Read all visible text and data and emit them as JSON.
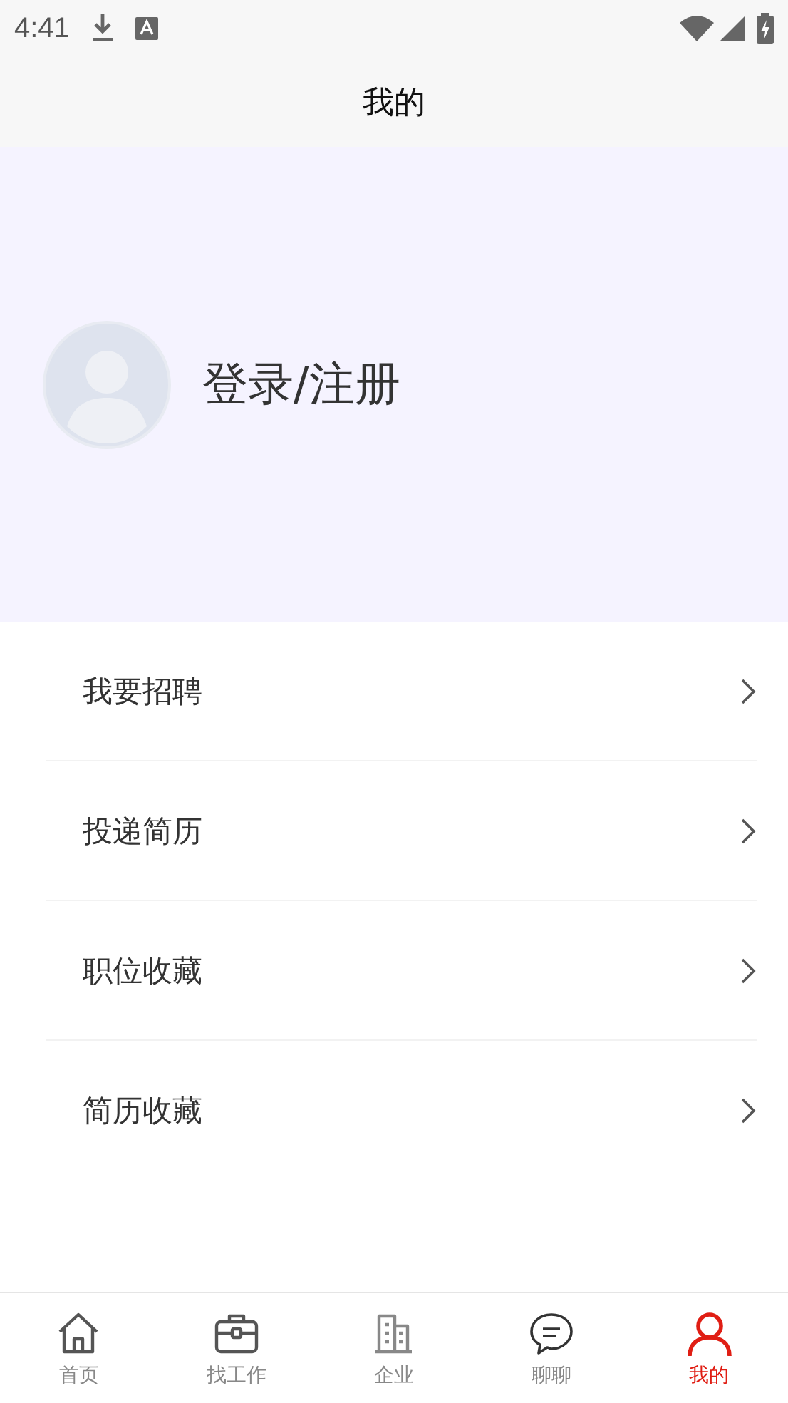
{
  "status_bar": {
    "time": "4:41"
  },
  "header": {
    "title": "我的"
  },
  "profile": {
    "login_text": "登录/注册"
  },
  "menu": [
    {
      "label": "我要招聘"
    },
    {
      "label": "投递简历"
    },
    {
      "label": "职位收藏"
    },
    {
      "label": "简历收藏"
    }
  ],
  "tab_bar": [
    {
      "label": "首页",
      "kind": "home",
      "selected": false
    },
    {
      "label": "找工作",
      "kind": "jobs",
      "selected": false
    },
    {
      "label": "企业",
      "kind": "company",
      "selected": false
    },
    {
      "label": "聊聊",
      "kind": "chat",
      "selected": false
    },
    {
      "label": "我的",
      "kind": "me",
      "selected": true
    }
  ]
}
